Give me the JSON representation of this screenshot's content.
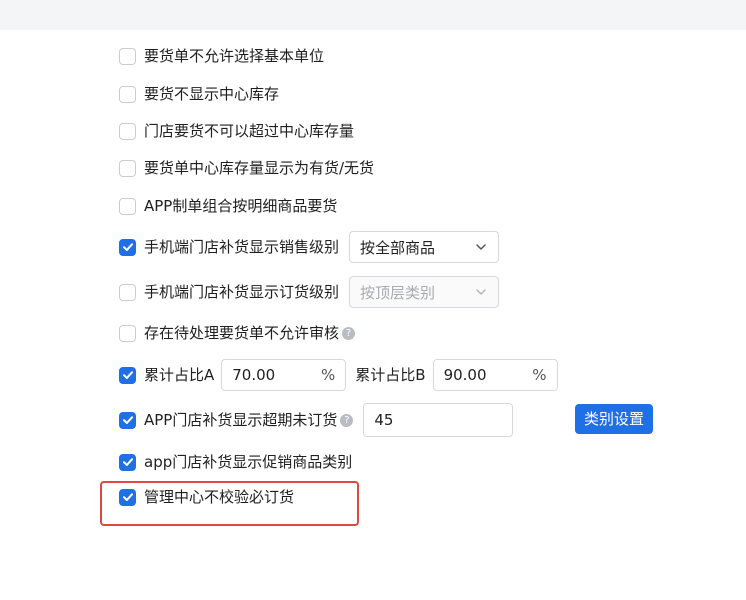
{
  "settings": [
    {
      "label": "要货单不允许选择基本单位",
      "checked": false
    },
    {
      "label": "要货不显示中心库存",
      "checked": false
    },
    {
      "label": "门店要货不可以超过中心库存量",
      "checked": false
    },
    {
      "label": "要货单中心库存量显示为有货/无货",
      "checked": false
    },
    {
      "label": "APP制单组合按明细商品要货",
      "checked": false
    },
    {
      "label": "手机端门店补货显示销售级别",
      "checked": true
    },
    {
      "label": "手机端门店补货显示订货级别",
      "checked": false
    },
    {
      "label": "存在待处理要货单不允许审核",
      "checked": false
    },
    {
      "label": "累计占比A",
      "checked": true
    },
    {
      "label": "APP门店补货显示超期未订货",
      "checked": true
    },
    {
      "label": "app门店补货显示促销商品类别",
      "checked": true
    },
    {
      "label": "管理中心不校验必订货",
      "checked": true
    }
  ],
  "sales_level_select": {
    "value": "按全部商品"
  },
  "order_level_select": {
    "value": "按顶层类别"
  },
  "ratio_a": {
    "value": "70.00",
    "unit": "%"
  },
  "ratio_b": {
    "label": "累计占比B",
    "value": "90.00",
    "unit": "%"
  },
  "overdue_days": {
    "value": "45"
  },
  "category_settings_button": {
    "label": "类别设置"
  },
  "help_icon_glyph": "?",
  "colors": {
    "accent": "#1f6fe5",
    "highlight": "#e0483e"
  }
}
